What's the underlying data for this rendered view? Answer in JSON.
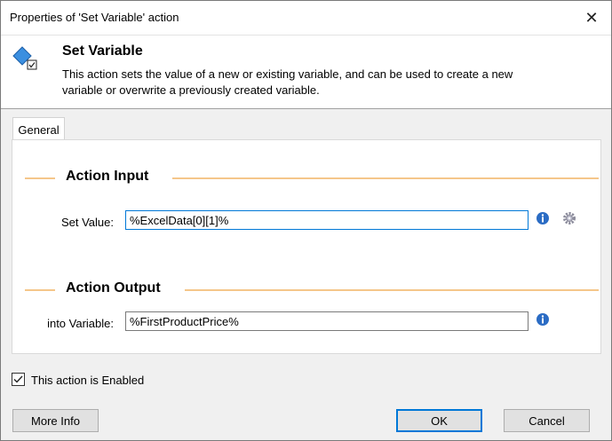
{
  "window": {
    "title": "Properties of 'Set Variable' action"
  },
  "header": {
    "title": "Set Variable",
    "description": "This action sets the value of a new or existing variable, and can be used to create a new variable or overwrite a previously created variable."
  },
  "tabs": [
    {
      "label": "General",
      "selected": true
    }
  ],
  "action_input": {
    "section_label": "Action Input",
    "set_value_label": "Set Value:",
    "set_value": "%ExcelData[0][1]%"
  },
  "action_output": {
    "section_label": "Action Output",
    "into_variable_label": "into Variable:",
    "into_variable": "%FirstProductPrice%"
  },
  "enabled": {
    "label": "This action is Enabled",
    "checked": true
  },
  "buttons": {
    "more_info": "More Info",
    "ok": "OK",
    "cancel": "Cancel"
  },
  "icons": {
    "close": "close-icon",
    "action": "set-variable-icon",
    "info": "info-icon",
    "settings": "gear-icon"
  },
  "colors": {
    "accent": "#0078d7",
    "section_line": "#f5c68a"
  }
}
